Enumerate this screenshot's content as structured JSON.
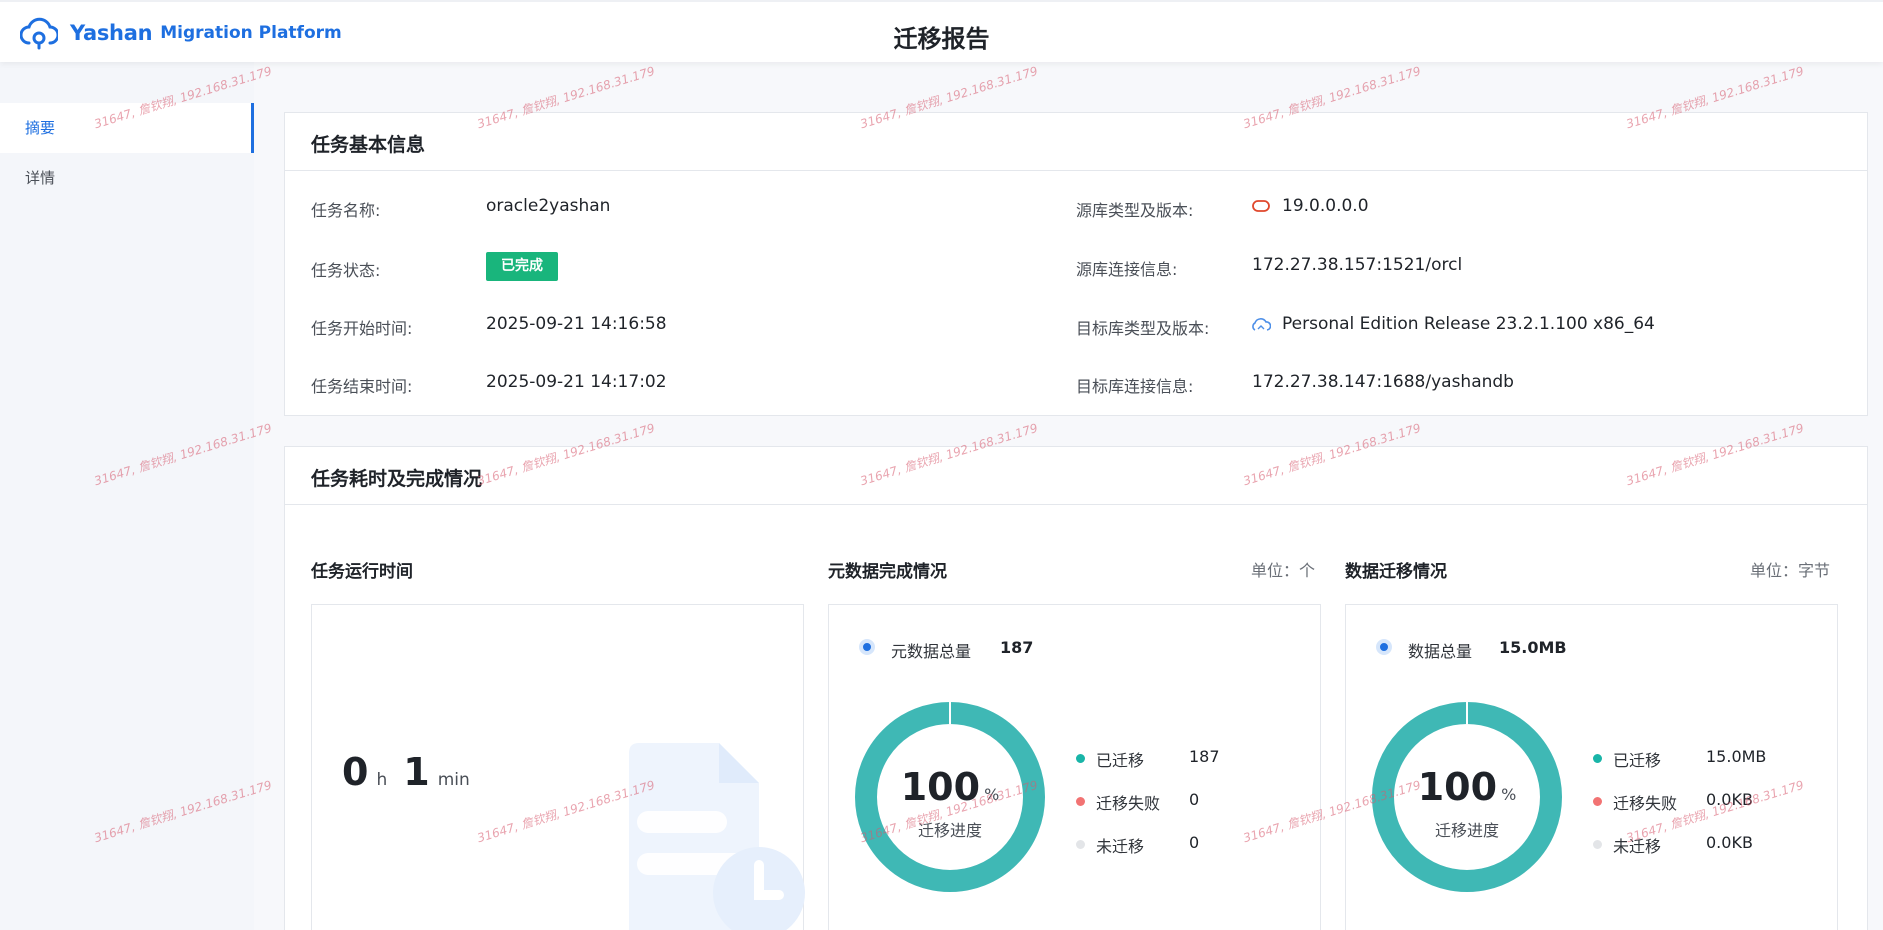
{
  "header": {
    "brand_primary": "Yashan",
    "brand_secondary": "Migration Platform",
    "page_title": "迁移报告",
    "logo_icon": "cloud-icon",
    "brand_color": "#1e6fe0"
  },
  "sidebar": {
    "items": [
      {
        "label": "摘要",
        "active": true
      },
      {
        "label": "详情",
        "active": false
      }
    ]
  },
  "basic_info": {
    "title": "任务基本信息",
    "left": [
      {
        "label": "任务名称:",
        "value": "oracle2yashan"
      },
      {
        "label": "任务状态:",
        "value": "已完成"
      },
      {
        "label": "任务开始时间:",
        "value": "2025-09-21 14:16:58"
      },
      {
        "label": "任务结束时间:",
        "value": "2025-09-21 14:17:02"
      }
    ],
    "right": [
      {
        "label": "源库类型及版本:",
        "value": "19.0.0.0.0",
        "icon": "oracle-icon"
      },
      {
        "label": "源库连接信息:",
        "value": "172.27.38.157:1521/orcl"
      },
      {
        "label": "目标库类型及版本:",
        "value": "Personal Edition Release 23.2.1.100 x86_64",
        "icon": "yashan-cloud-icon"
      },
      {
        "label": "目标库连接信息:",
        "value": "172.27.38.147:1688/yashandb"
      }
    ],
    "status_color": "#19b57c"
  },
  "duration": {
    "title": "任务耗时及完成情况",
    "runtime": {
      "title": "任务运行时间",
      "hours": "0",
      "hours_unit": "h",
      "minutes": "1",
      "minutes_unit": "min",
      "illustration_icon": "document-clock-icon"
    },
    "metadata": {
      "title": "元数据完成情况",
      "unit": "单位：个",
      "total_label": "元数据总量",
      "total_value": "187",
      "percent": "100",
      "percent_sign": "%",
      "progress_label": "迁移进度",
      "progress_fraction": 1.0,
      "legend": [
        {
          "label": "已迁移",
          "value": "187",
          "color": "#19b5a8"
        },
        {
          "label": "迁移失败",
          "value": "0",
          "color": "#f27373"
        },
        {
          "label": "未迁移",
          "value": "0",
          "color": "#e3e5e8"
        }
      ]
    },
    "data_migration": {
      "title": "数据迁移情况",
      "unit": "单位：字节",
      "total_label": "数据总量",
      "total_value": "15.0MB",
      "percent": "100",
      "percent_sign": "%",
      "progress_label": "迁移进度",
      "progress_fraction": 1.0,
      "legend": [
        {
          "label": "已迁移",
          "value": "15.0MB",
          "color": "#19b5a8"
        },
        {
          "label": "迁移失败",
          "value": "0.0KB",
          "color": "#f27373"
        },
        {
          "label": "未迁移",
          "value": "0.0KB",
          "color": "#e3e5e8"
        }
      ]
    },
    "ring_color": "#3fb8b5"
  },
  "watermark_text": "31647, 詹钦翔, 192.168.31.179"
}
